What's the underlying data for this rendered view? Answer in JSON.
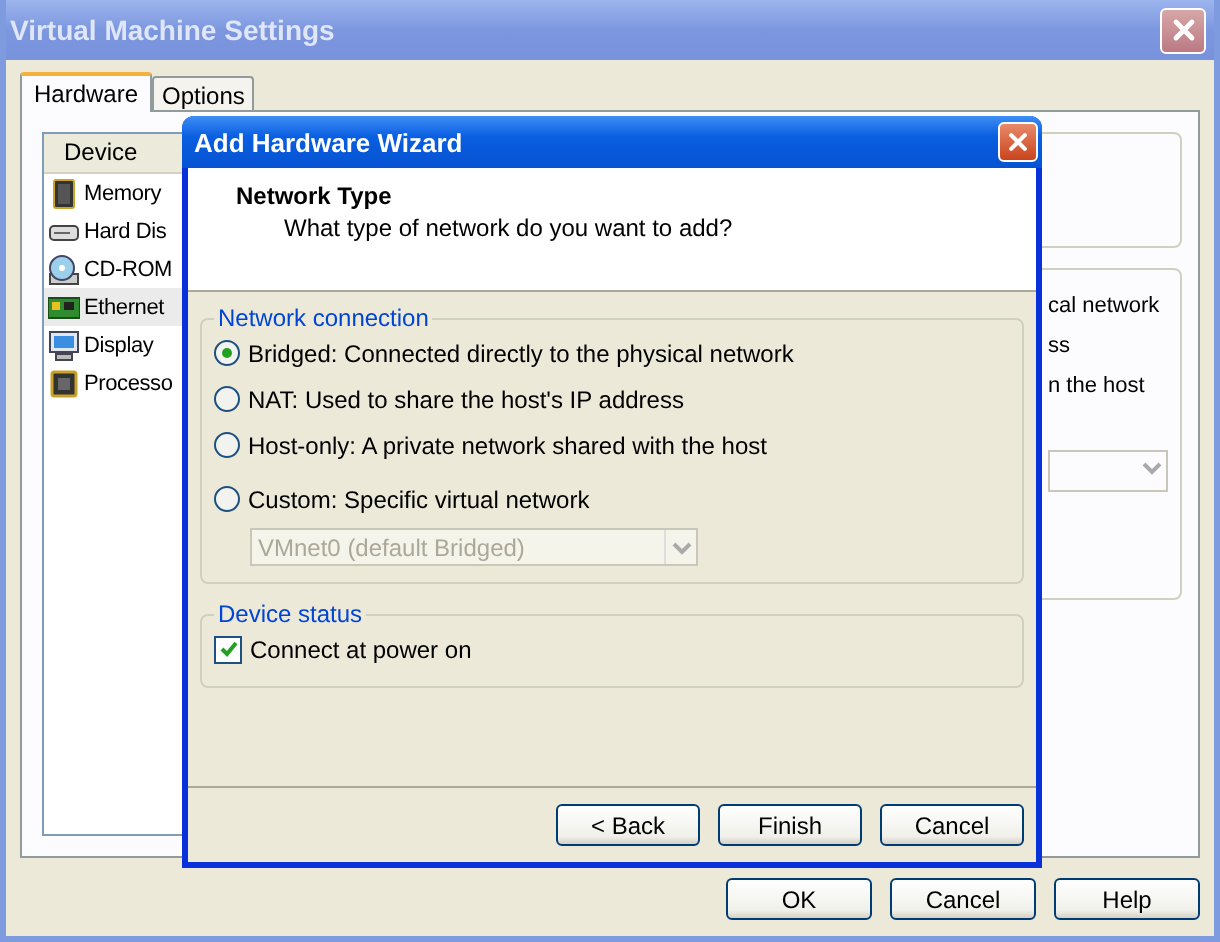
{
  "window": {
    "title": "Virtual Machine Settings"
  },
  "tabs": [
    {
      "label": "Hardware",
      "selected": true
    },
    {
      "label": "Options",
      "selected": false
    }
  ],
  "devices": {
    "header": "Device",
    "items": [
      {
        "name": "Memory",
        "kind": "memory",
        "selected": false
      },
      {
        "name": "Hard Dis",
        "kind": "disk",
        "selected": false
      },
      {
        "name": "CD-ROM",
        "kind": "cdrom",
        "selected": false
      },
      {
        "name": "Ethernet",
        "kind": "ethernet",
        "selected": true
      },
      {
        "name": "Display",
        "kind": "display",
        "selected": false
      },
      {
        "name": "Processo",
        "kind": "processor",
        "selected": false
      }
    ]
  },
  "background_texts": [
    "cal network",
    "ss",
    "n the host"
  ],
  "buttons": [
    {
      "label": "OK"
    },
    {
      "label": "Cancel"
    },
    {
      "label": "Help"
    }
  ],
  "dialog": {
    "title": "Add Hardware Wizard",
    "heading": "Network Type",
    "subtitle": "What type of network do you want to add?",
    "network_group": {
      "title": "Network connection",
      "options": [
        {
          "label": "Bridged: Connected directly to the physical network",
          "selected": true
        },
        {
          "label": "NAT: Used to share the host's IP address",
          "selected": false
        },
        {
          "label": "Host-only: A private network shared with the host",
          "selected": false
        },
        {
          "label": "Custom: Specific virtual network",
          "selected": false
        }
      ],
      "dropdown": {
        "value": "VMnet0 (default Bridged)",
        "disabled": true
      }
    },
    "status_group": {
      "title": "Device status",
      "checkbox": {
        "label": "Connect at power on",
        "checked": true
      }
    },
    "buttons": [
      {
        "label": "< Back"
      },
      {
        "label": "Finish"
      },
      {
        "label": "Cancel"
      }
    ]
  }
}
